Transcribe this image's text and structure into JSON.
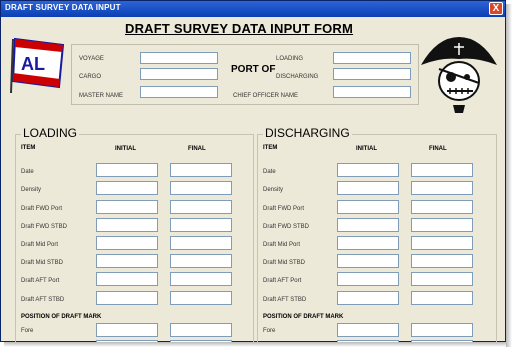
{
  "window": {
    "title": "DRAFT SURVEY DATA INPUT",
    "close_label": "X"
  },
  "form": {
    "title": "DRAFT SURVEY DATA INPUT FORM"
  },
  "header": {
    "voyage_label": "VOYAGE",
    "cargo_label": "CARGO",
    "master_label": "MASTER NAME",
    "port_of_label": "PORT OF",
    "loading_label": "LOADING",
    "discharging_label": "DISCHARGING",
    "chief_officer_label": "CHIEF OFFICER NAME"
  },
  "logo": {
    "text": "AL"
  },
  "loading": {
    "title": "LOADING",
    "item_header": "ITEM",
    "initial_header": "INITIAL",
    "final_header": "FINAL",
    "rows": [
      "Date",
      "Density",
      "Draft FWD Port",
      "Draft FWD STBD",
      "Draft Mid Port",
      "Draft Mid STBD",
      "Draft AFT Port",
      "Draft AFT STBD"
    ],
    "section_label": "POSITION OF DRAFT MARK",
    "section_rows": [
      "Fore"
    ]
  },
  "discharging": {
    "title": "DISCHARGING",
    "item_header": "ITEM",
    "initial_header": "INITIAL",
    "final_header": "FINAL",
    "rows": [
      "Date",
      "Density",
      "Draft FWD Port",
      "Draft FWD STBD",
      "Draft Mid Port",
      "Draft Mid STBD",
      "Draft AFT Port",
      "Draft AFT STBD"
    ],
    "section_label": "POSITION OF DRAFT MARK",
    "section_rows": [
      "Fore"
    ]
  },
  "colors": {
    "titlebar": "#0a3fb5",
    "window_bg": "#ece9d8",
    "flag_red": "#cc0000",
    "flag_blue": "#1a1aa0"
  }
}
